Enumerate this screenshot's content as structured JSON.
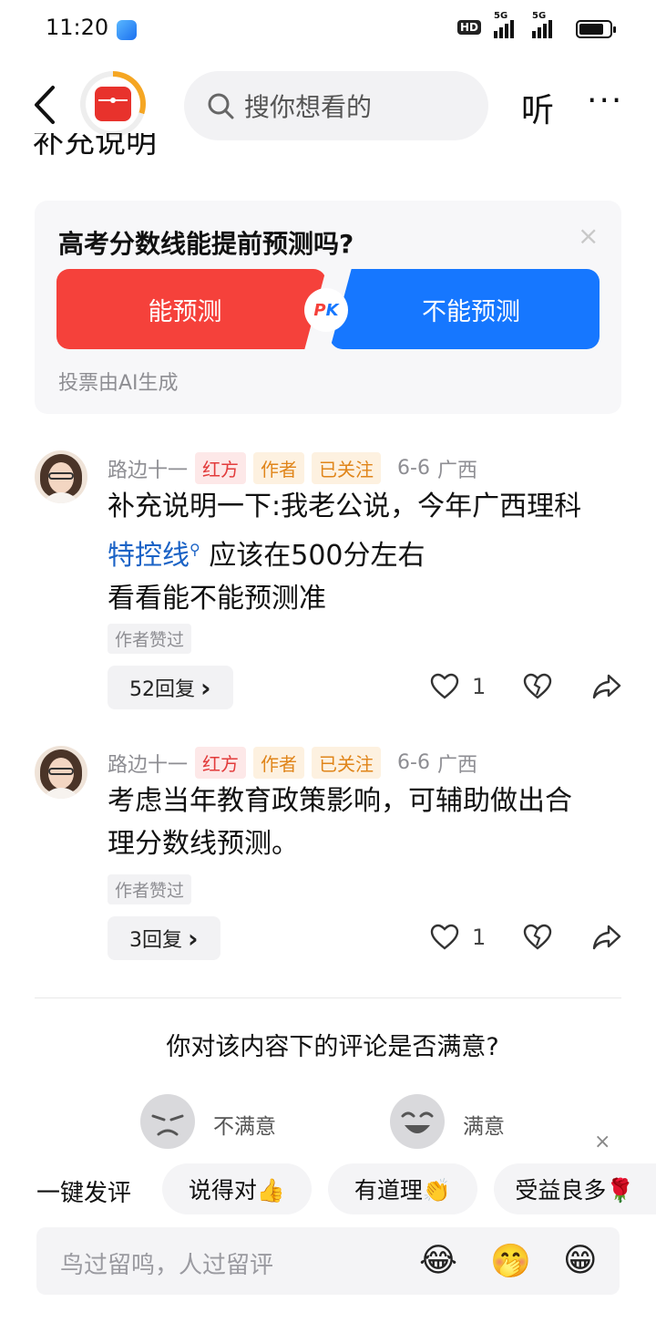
{
  "status": {
    "time": "11:20",
    "hd_label": "HD",
    "net1": "5G",
    "net2": "5G",
    "battery_level": 0.8
  },
  "header": {
    "search_placeholder": "搜你想看的",
    "listen_label": "听",
    "more_label": "···",
    "partial_text": "补充说明"
  },
  "poll": {
    "question": "高考分数线能提前预测吗?",
    "close_label": "×",
    "option_a": "能预测",
    "option_b": "不能预测",
    "pk_p": "P",
    "pk_k": "K",
    "note": "投票由AI生成",
    "colors": {
      "a": "#f5413b",
      "b": "#1677ff"
    }
  },
  "comments": [
    {
      "author": "路边十一",
      "tags": [
        "红方",
        "作者",
        "已关注"
      ],
      "date": "6-6",
      "location": "广西",
      "line1": "补充说明一下:我老公说，今年广西理科",
      "link": "特控线",
      "link_icon": "⚲",
      "line2_rest": " 应该在500分左右",
      "line3": "看看能不能预测准",
      "liked_badge": "作者赞过",
      "replies": "52回复",
      "replies_chevron": "›",
      "likes": "1"
    },
    {
      "author": "路边十一",
      "tags": [
        "红方",
        "作者",
        "已关注"
      ],
      "date": "6-6",
      "location": "广西",
      "line1": "考虑当年教育政策影响，可辅助做出合",
      "line2": "理分数线预测。",
      "liked_badge": "作者赞过",
      "replies": "3回复",
      "replies_chevron": "›",
      "likes": "1"
    }
  ],
  "satisfaction": {
    "question": "你对该内容下的评论是否满意?",
    "unsatisfied": "不满意",
    "satisfied": "满意",
    "close_label": "×"
  },
  "quick_reply": {
    "lead": "一键发评",
    "chips": [
      "说得对👍",
      "有道理👏",
      "受益良多🌹"
    ]
  },
  "input": {
    "placeholder": "鸟过留鸣，人过留评",
    "emojis": [
      "😂",
      "🤭",
      "😁"
    ]
  }
}
